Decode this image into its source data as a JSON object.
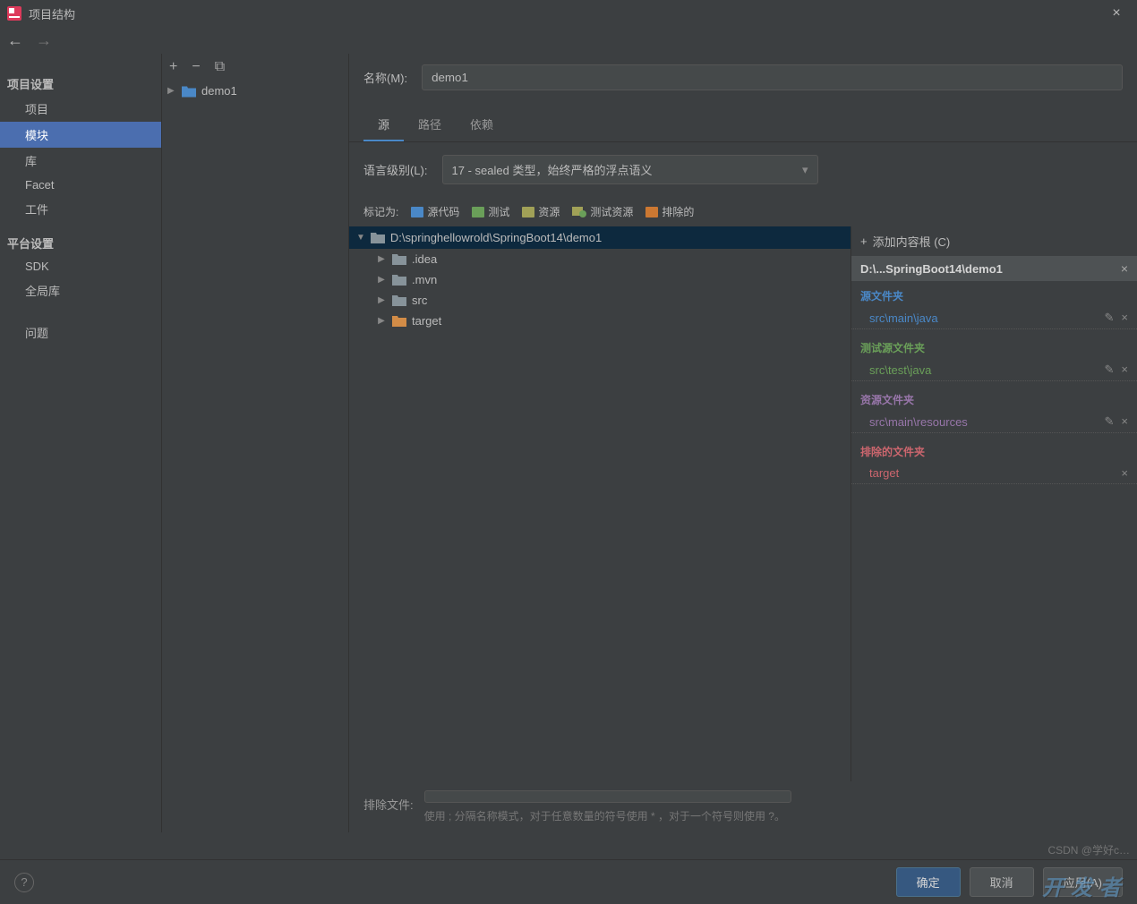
{
  "window": {
    "title": "项目结构"
  },
  "sidebar": {
    "section1": "项目设置",
    "items1": [
      "项目",
      "模块",
      "库",
      "Facet",
      "工件"
    ],
    "section2": "平台设置",
    "items2": [
      "SDK",
      "全局库"
    ],
    "problems": "问题"
  },
  "middle": {
    "module": "demo1"
  },
  "content": {
    "name_label": "名称(M):",
    "name_value": "demo1",
    "tabs": [
      "源",
      "路径",
      "依赖"
    ],
    "lang_label": "语言级别(L):",
    "lang_value": "17 - sealed 类型，始终严格的浮点语义",
    "mark_label": "标记为:",
    "marks": [
      {
        "label": "源代码",
        "color": "#4a88c7"
      },
      {
        "label": "测试",
        "color": "#6a9f59"
      },
      {
        "label": "资源",
        "color": "#a1a157"
      },
      {
        "label": "测试资源",
        "color": "#a1a157"
      },
      {
        "label": "排除的",
        "color": "#cc7832"
      }
    ],
    "tree": {
      "root": "D:\\springhellowrold\\SpringBoot14\\demo1",
      "children": [
        {
          "name": ".idea",
          "color": "gray"
        },
        {
          "name": ".mvn",
          "color": "gray"
        },
        {
          "name": "src",
          "color": "gray"
        },
        {
          "name": "target",
          "color": "orange"
        }
      ]
    },
    "exclude_label": "排除文件:",
    "exclude_hint": "使用 ; 分隔名称模式，对于任意数量的符号使用 * ，对于一个符号则使用 ?。"
  },
  "right": {
    "add_root": "添加内容根 (C)",
    "root_path": "D:\\...SpringBoot14\\demo1",
    "groups": [
      {
        "title": "源文件夹",
        "class": "blue",
        "entries": [
          "src\\main\\java"
        ]
      },
      {
        "title": "测试源文件夹",
        "class": "green",
        "entries": [
          "src\\test\\java"
        ]
      },
      {
        "title": "资源文件夹",
        "class": "purple",
        "entries": [
          "src\\main\\resources"
        ]
      },
      {
        "title": "排除的文件夹",
        "class": "red",
        "entries": [
          "target"
        ]
      }
    ]
  },
  "footer": {
    "ok": "确定",
    "cancel": "取消",
    "apply": "应用(A)"
  },
  "watermark": "CSDN @学好c…",
  "watermark2": "开发者"
}
